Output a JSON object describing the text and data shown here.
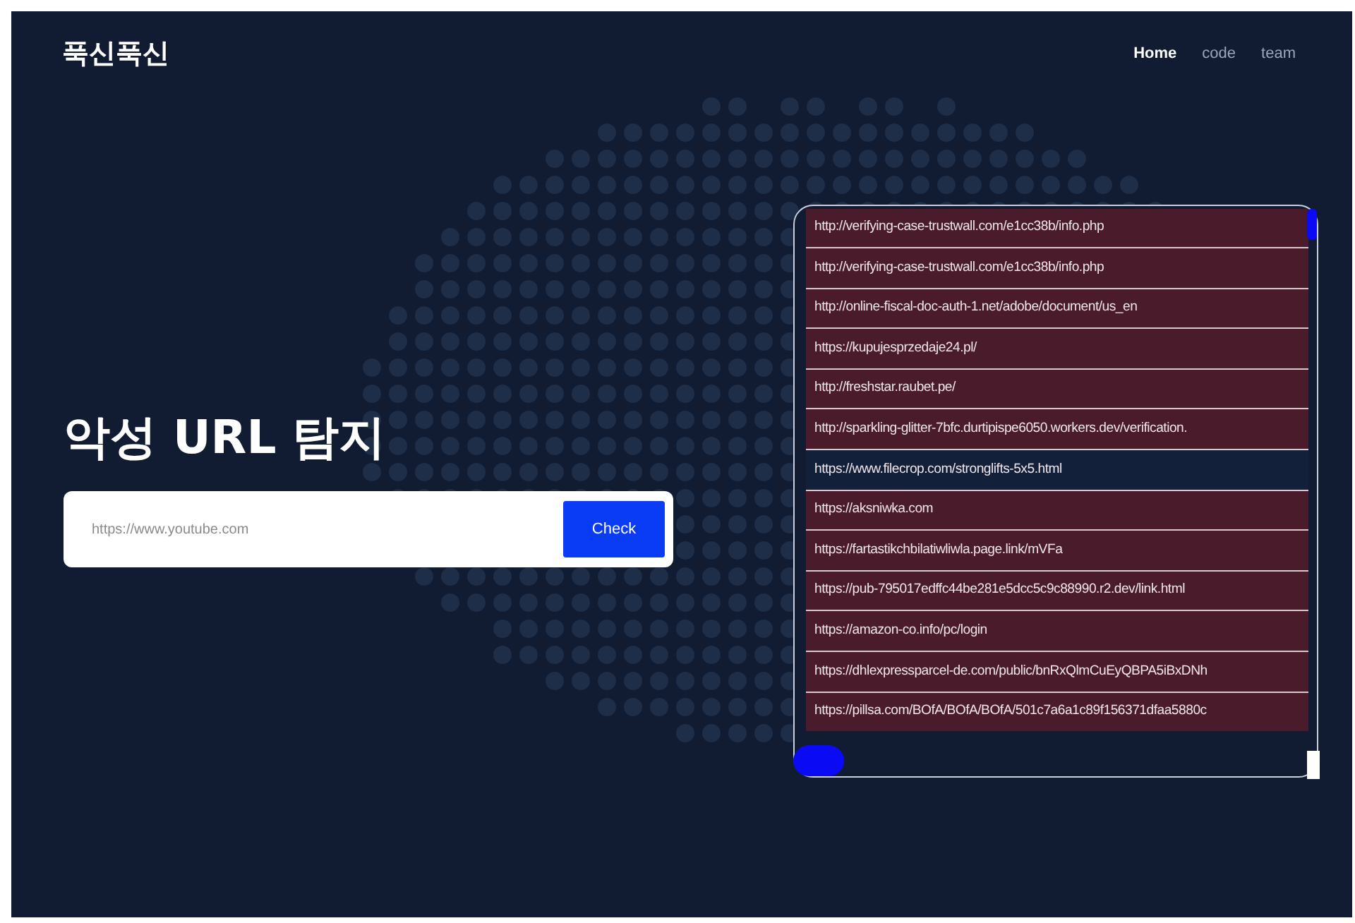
{
  "brand": "푹신푹신",
  "nav": [
    {
      "label": "Home",
      "selected": true
    },
    {
      "label": "code",
      "selected": false
    },
    {
      "label": "team",
      "selected": false
    }
  ],
  "hero": {
    "title": "악성 URL 탐지",
    "search": {
      "placeholder": "https://www.youtube.com"
    },
    "button": "Check"
  },
  "results": [
    {
      "url": "http://verifying-case-trustwall.com/e1cc38b/info.php",
      "malicious": true
    },
    {
      "url": "http://verifying-case-trustwall.com/e1cc38b/info.php",
      "malicious": true
    },
    {
      "url": "http://online-fiscal-doc-auth-1.net/adobe/document/us_en",
      "malicious": true
    },
    {
      "url": "https://kupujesprzedaje24.pl/",
      "malicious": true
    },
    {
      "url": "http://freshstar.raubet.pe/",
      "malicious": true
    },
    {
      "url": "http://sparkling-glitter-7bfc.durtipispe6050.workers.dev/verification.",
      "malicious": true
    },
    {
      "url": "https://www.filecrop.com/stronglifts-5x5.html",
      "malicious": false
    },
    {
      "url": "https://aksniwka.com",
      "malicious": true
    },
    {
      "url": "https://fartastikchbilatiwliwla.page.link/mVFa",
      "malicious": true
    },
    {
      "url": "https://pub-795017edffc44be281e5dcc5c9c88990.r2.dev/link.html",
      "malicious": true
    },
    {
      "url": "https://amazon-co.info/pc/login",
      "malicious": true
    },
    {
      "url": "https://dhlexpressparcel-de.com/public/bnRxQlmCuEyQBPA5iBxDNh",
      "malicious": true
    },
    {
      "url": "https://pillsa.com/BOfA/BOfA/BOfA/501c7a6a1c89f156371dfaa5880c",
      "malicious": true
    }
  ]
}
